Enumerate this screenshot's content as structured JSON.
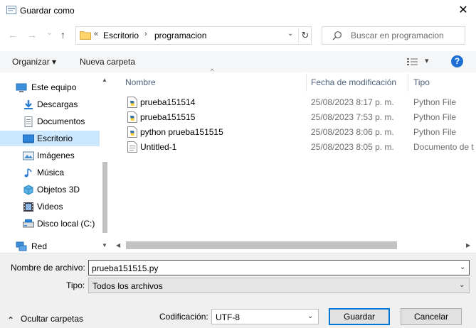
{
  "window": {
    "title": "Guardar como",
    "close_glyph": "✕"
  },
  "nav": {
    "back_glyph": "←",
    "forward_glyph": "→",
    "recent_glyph": "⌄",
    "up_glyph": "↑"
  },
  "address": {
    "overflow_glyph": "«",
    "separator_glyph": "›",
    "path": [
      "Escritorio",
      "programacion"
    ],
    "dropdown_glyph": "⌄",
    "refresh_glyph": "↻"
  },
  "search": {
    "placeholder": "Buscar en programacion"
  },
  "toolbar": {
    "organize_label": "Organizar ▾",
    "new_folder_label": "Nueva carpeta",
    "view_dropdown_glyph": "▾",
    "help_glyph": "?"
  },
  "tree": {
    "items": [
      {
        "label": "Este equipo",
        "icon": "computer-icon",
        "selected": false
      },
      {
        "label": "Descargas",
        "icon": "download-icon",
        "selected": false
      },
      {
        "label": "Documentos",
        "icon": "documents-icon",
        "selected": false
      },
      {
        "label": "Escritorio",
        "icon": "desktop-icon",
        "selected": true
      },
      {
        "label": "Imágenes",
        "icon": "pictures-icon",
        "selected": false
      },
      {
        "label": "Música",
        "icon": "music-icon",
        "selected": false
      },
      {
        "label": "Objetos 3D",
        "icon": "objects3d-icon",
        "selected": false
      },
      {
        "label": "Videos",
        "icon": "videos-icon",
        "selected": false
      },
      {
        "label": "Disco local (C:)",
        "icon": "drive-icon",
        "selected": false
      },
      {
        "label": "Red",
        "icon": "network-icon",
        "selected": false
      }
    ],
    "scroll_up_glyph": "▲",
    "scroll_down_glyph": "▼"
  },
  "files": {
    "columns": [
      "Nombre",
      "Fecha de modificación",
      "Tipo"
    ],
    "sort_glyph": "^",
    "rows": [
      {
        "name": "prueba151514",
        "date": "25/08/2023 8:17 p. m.",
        "type": "Python File",
        "icon": "python-file-icon"
      },
      {
        "name": "prueba151515",
        "date": "25/08/2023 7:53 p. m.",
        "type": "Python File",
        "icon": "python-file-icon"
      },
      {
        "name": "python prueba151515",
        "date": "25/08/2023 8:06 p. m.",
        "type": "Python File",
        "icon": "python-file-icon"
      },
      {
        "name": "Untitled-1",
        "date": "25/08/2023 8:05 p. m.",
        "type": "Documento de t",
        "icon": "text-file-icon"
      }
    ],
    "scroll_left_glyph": "◀",
    "scroll_right_glyph": "▶"
  },
  "form": {
    "filename_label": "Nombre de archivo:",
    "filename_value": "prueba151515.py",
    "filetype_label": "Tipo:",
    "filetype_value": "Todos los archivos",
    "dropdown_glyph": "⌄"
  },
  "footer": {
    "hide_folders_label": "Ocultar carpetas",
    "hide_folders_glyph": "⌃",
    "encoding_label": "Codificación:",
    "encoding_value": "UTF-8",
    "save_label": "Guardar",
    "cancel_label": "Cancelar"
  },
  "colors": {
    "accent": "#0078d7",
    "selection": "#cce8ff",
    "help_blue": "#1e6fd4",
    "header_text": "#4c607a"
  }
}
